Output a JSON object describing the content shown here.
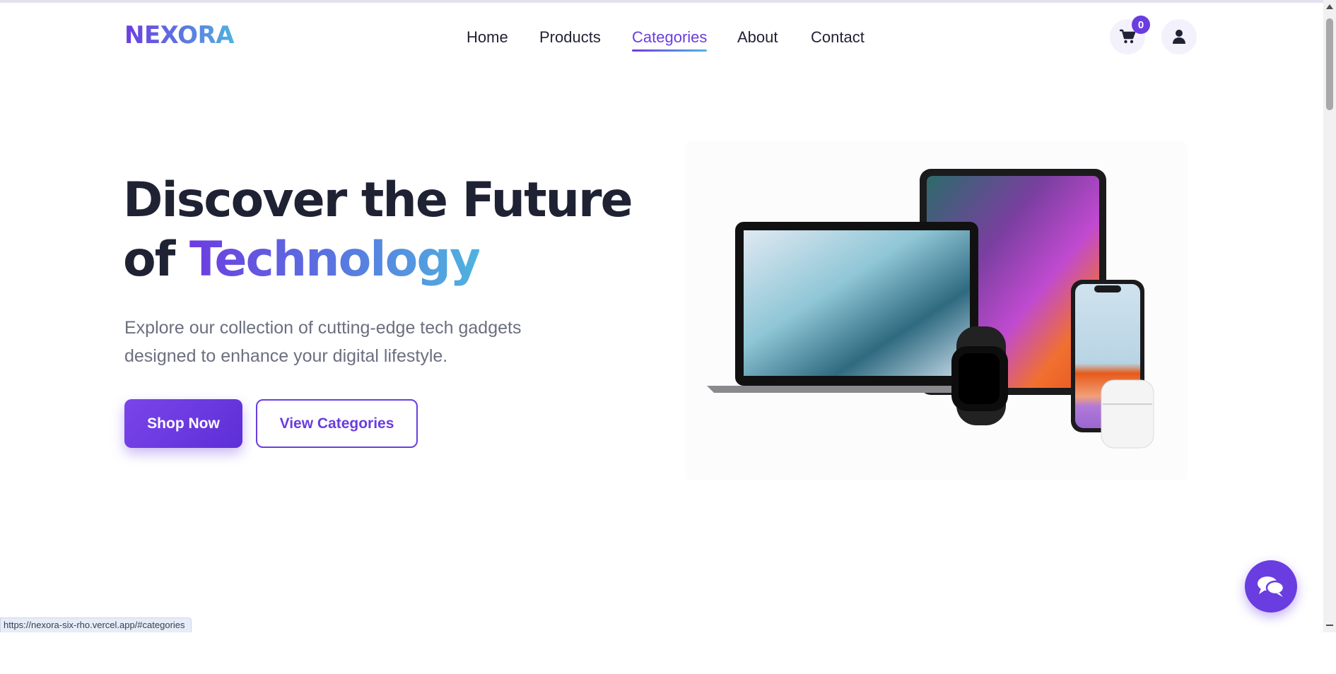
{
  "brand": {
    "logo_text": "NEXORA"
  },
  "nav": {
    "items": [
      {
        "label": "Home",
        "active": false
      },
      {
        "label": "Products",
        "active": false
      },
      {
        "label": "Categories",
        "active": true
      },
      {
        "label": "About",
        "active": false
      },
      {
        "label": "Contact",
        "active": false
      }
    ]
  },
  "header": {
    "cart_icon": "cart-icon",
    "cart_count": "0",
    "user_icon": "user-icon"
  },
  "hero": {
    "title_line1": "Discover the Future",
    "title_line2_prefix": "of ",
    "title_line2_highlight": "Technology",
    "description": "Explore our collection of cutting-edge tech gadgets designed to enhance your digital lifestyle.",
    "primary_button": "Shop Now",
    "secondary_button": "View Categories",
    "image_subject": "laptop, tablet, smartwatch, smartphone and earbuds"
  },
  "chat": {
    "icon": "chat-bubbles-icon"
  },
  "status_bar": {
    "url": "https://nexora-six-rho.vercel.app/#categories"
  },
  "colors": {
    "accent": "#6a3de0",
    "accent_light": "#4fb3df",
    "text_dark": "#1f2233",
    "text_muted": "#6b6f80"
  }
}
